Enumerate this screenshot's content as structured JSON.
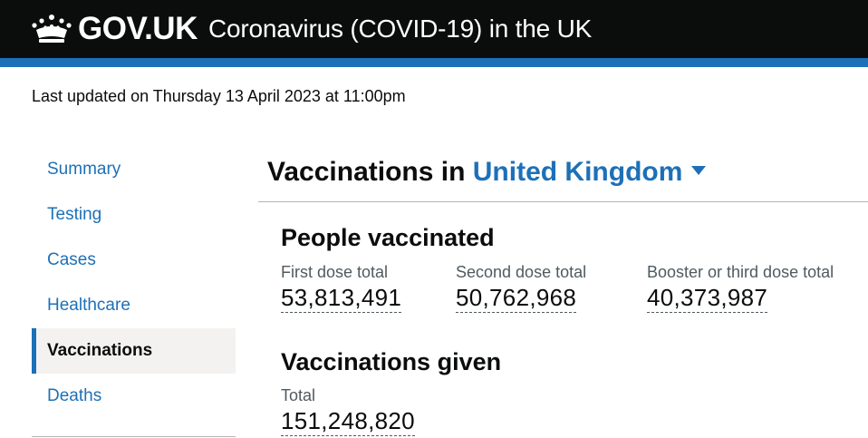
{
  "header": {
    "logo_text": "GOV.UK",
    "service_name": "Coronavirus (COVID-19) in the UK",
    "bg_color": "#0b0c0c",
    "stripe_color": "#1d70b8"
  },
  "last_updated": "Last updated on Thursday 13 April 2023 at 11:00pm",
  "sidenav": {
    "items": [
      {
        "label": "Summary"
      },
      {
        "label": "Testing"
      },
      {
        "label": "Cases"
      },
      {
        "label": "Healthcare"
      },
      {
        "label": "Vaccinations",
        "active": true
      },
      {
        "label": "Deaths"
      }
    ]
  },
  "main": {
    "heading_prefix": "Vaccinations in",
    "area": "United Kingdom",
    "people_vaccinated": {
      "title": "People vaccinated",
      "metrics": [
        {
          "label": "First dose total",
          "value": "53,813,491"
        },
        {
          "label": "Second dose total",
          "value": "50,762,968"
        },
        {
          "label": "Booster or third dose total",
          "value": "40,373,987"
        }
      ]
    },
    "vaccinations_given": {
      "title": "Vaccinations given",
      "metrics": [
        {
          "label": "Total",
          "value": "151,248,820"
        }
      ]
    }
  }
}
